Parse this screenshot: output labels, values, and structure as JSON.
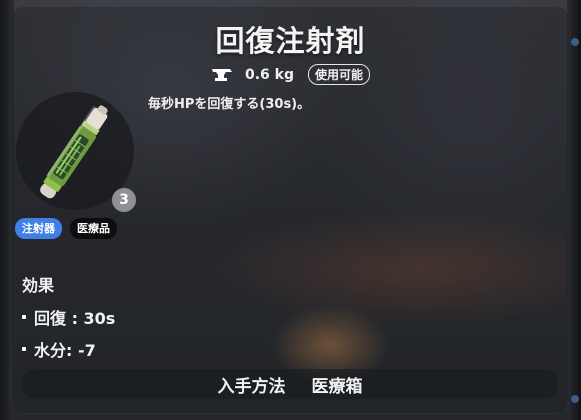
{
  "item": {
    "title": "回復注射剤",
    "weight": "0.6 kg",
    "usable_label": "使用可能",
    "description": "毎秒HPを回復する(30s)。",
    "count": "3",
    "tags": [
      "注射器",
      "医療品"
    ]
  },
  "effects": {
    "header": "効果",
    "rows": [
      "回復 : 30s",
      "水分: -7"
    ]
  },
  "source": {
    "label": "入手方法",
    "value": "医療箱"
  },
  "icons": {
    "weight": "anvil-icon",
    "item": "syringe-item"
  },
  "colors": {
    "tag_syringe": "#3f7fe6",
    "tag_medical": "#0d0d0f",
    "count_badge": "#8e9095"
  }
}
